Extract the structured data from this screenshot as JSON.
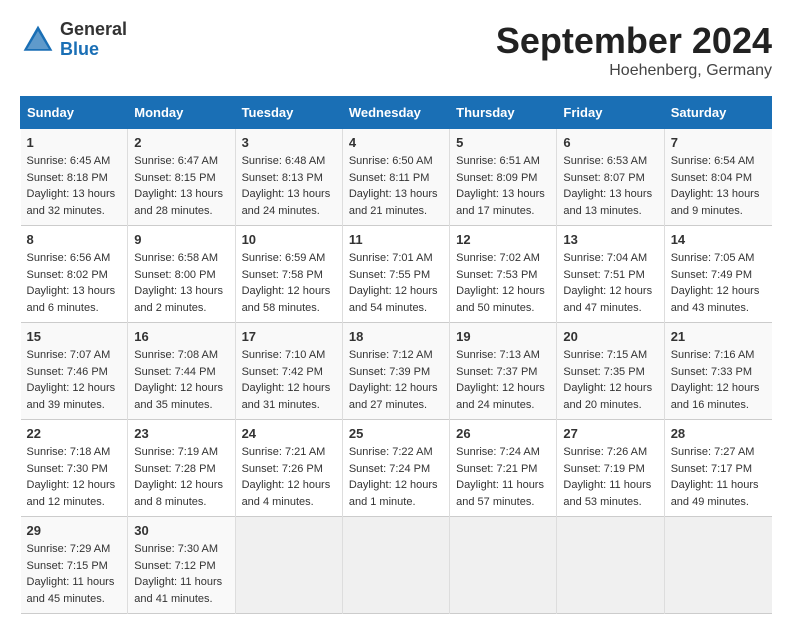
{
  "header": {
    "logo_general": "General",
    "logo_blue": "Blue",
    "month_title": "September 2024",
    "location": "Hoehenberg, Germany"
  },
  "days_of_week": [
    "Sunday",
    "Monday",
    "Tuesday",
    "Wednesday",
    "Thursday",
    "Friday",
    "Saturday"
  ],
  "weeks": [
    [
      {
        "day": "1",
        "lines": [
          "Sunrise: 6:45 AM",
          "Sunset: 8:18 PM",
          "Daylight: 13 hours",
          "and 32 minutes."
        ]
      },
      {
        "day": "2",
        "lines": [
          "Sunrise: 6:47 AM",
          "Sunset: 8:15 PM",
          "Daylight: 13 hours",
          "and 28 minutes."
        ]
      },
      {
        "day": "3",
        "lines": [
          "Sunrise: 6:48 AM",
          "Sunset: 8:13 PM",
          "Daylight: 13 hours",
          "and 24 minutes."
        ]
      },
      {
        "day": "4",
        "lines": [
          "Sunrise: 6:50 AM",
          "Sunset: 8:11 PM",
          "Daylight: 13 hours",
          "and 21 minutes."
        ]
      },
      {
        "day": "5",
        "lines": [
          "Sunrise: 6:51 AM",
          "Sunset: 8:09 PM",
          "Daylight: 13 hours",
          "and 17 minutes."
        ]
      },
      {
        "day": "6",
        "lines": [
          "Sunrise: 6:53 AM",
          "Sunset: 8:07 PM",
          "Daylight: 13 hours",
          "and 13 minutes."
        ]
      },
      {
        "day": "7",
        "lines": [
          "Sunrise: 6:54 AM",
          "Sunset: 8:04 PM",
          "Daylight: 13 hours",
          "and 9 minutes."
        ]
      }
    ],
    [
      {
        "day": "8",
        "lines": [
          "Sunrise: 6:56 AM",
          "Sunset: 8:02 PM",
          "Daylight: 13 hours",
          "and 6 minutes."
        ]
      },
      {
        "day": "9",
        "lines": [
          "Sunrise: 6:58 AM",
          "Sunset: 8:00 PM",
          "Daylight: 13 hours",
          "and 2 minutes."
        ]
      },
      {
        "day": "10",
        "lines": [
          "Sunrise: 6:59 AM",
          "Sunset: 7:58 PM",
          "Daylight: 12 hours",
          "and 58 minutes."
        ]
      },
      {
        "day": "11",
        "lines": [
          "Sunrise: 7:01 AM",
          "Sunset: 7:55 PM",
          "Daylight: 12 hours",
          "and 54 minutes."
        ]
      },
      {
        "day": "12",
        "lines": [
          "Sunrise: 7:02 AM",
          "Sunset: 7:53 PM",
          "Daylight: 12 hours",
          "and 50 minutes."
        ]
      },
      {
        "day": "13",
        "lines": [
          "Sunrise: 7:04 AM",
          "Sunset: 7:51 PM",
          "Daylight: 12 hours",
          "and 47 minutes."
        ]
      },
      {
        "day": "14",
        "lines": [
          "Sunrise: 7:05 AM",
          "Sunset: 7:49 PM",
          "Daylight: 12 hours",
          "and 43 minutes."
        ]
      }
    ],
    [
      {
        "day": "15",
        "lines": [
          "Sunrise: 7:07 AM",
          "Sunset: 7:46 PM",
          "Daylight: 12 hours",
          "and 39 minutes."
        ]
      },
      {
        "day": "16",
        "lines": [
          "Sunrise: 7:08 AM",
          "Sunset: 7:44 PM",
          "Daylight: 12 hours",
          "and 35 minutes."
        ]
      },
      {
        "day": "17",
        "lines": [
          "Sunrise: 7:10 AM",
          "Sunset: 7:42 PM",
          "Daylight: 12 hours",
          "and 31 minutes."
        ]
      },
      {
        "day": "18",
        "lines": [
          "Sunrise: 7:12 AM",
          "Sunset: 7:39 PM",
          "Daylight: 12 hours",
          "and 27 minutes."
        ]
      },
      {
        "day": "19",
        "lines": [
          "Sunrise: 7:13 AM",
          "Sunset: 7:37 PM",
          "Daylight: 12 hours",
          "and 24 minutes."
        ]
      },
      {
        "day": "20",
        "lines": [
          "Sunrise: 7:15 AM",
          "Sunset: 7:35 PM",
          "Daylight: 12 hours",
          "and 20 minutes."
        ]
      },
      {
        "day": "21",
        "lines": [
          "Sunrise: 7:16 AM",
          "Sunset: 7:33 PM",
          "Daylight: 12 hours",
          "and 16 minutes."
        ]
      }
    ],
    [
      {
        "day": "22",
        "lines": [
          "Sunrise: 7:18 AM",
          "Sunset: 7:30 PM",
          "Daylight: 12 hours",
          "and 12 minutes."
        ]
      },
      {
        "day": "23",
        "lines": [
          "Sunrise: 7:19 AM",
          "Sunset: 7:28 PM",
          "Daylight: 12 hours",
          "and 8 minutes."
        ]
      },
      {
        "day": "24",
        "lines": [
          "Sunrise: 7:21 AM",
          "Sunset: 7:26 PM",
          "Daylight: 12 hours",
          "and 4 minutes."
        ]
      },
      {
        "day": "25",
        "lines": [
          "Sunrise: 7:22 AM",
          "Sunset: 7:24 PM",
          "Daylight: 12 hours",
          "and 1 minute."
        ]
      },
      {
        "day": "26",
        "lines": [
          "Sunrise: 7:24 AM",
          "Sunset: 7:21 PM",
          "Daylight: 11 hours",
          "and 57 minutes."
        ]
      },
      {
        "day": "27",
        "lines": [
          "Sunrise: 7:26 AM",
          "Sunset: 7:19 PM",
          "Daylight: 11 hours",
          "and 53 minutes."
        ]
      },
      {
        "day": "28",
        "lines": [
          "Sunrise: 7:27 AM",
          "Sunset: 7:17 PM",
          "Daylight: 11 hours",
          "and 49 minutes."
        ]
      }
    ],
    [
      {
        "day": "29",
        "lines": [
          "Sunrise: 7:29 AM",
          "Sunset: 7:15 PM",
          "Daylight: 11 hours",
          "and 45 minutes."
        ]
      },
      {
        "day": "30",
        "lines": [
          "Sunrise: 7:30 AM",
          "Sunset: 7:12 PM",
          "Daylight: 11 hours",
          "and 41 minutes."
        ]
      },
      {
        "day": "",
        "lines": []
      },
      {
        "day": "",
        "lines": []
      },
      {
        "day": "",
        "lines": []
      },
      {
        "day": "",
        "lines": []
      },
      {
        "day": "",
        "lines": []
      }
    ]
  ]
}
